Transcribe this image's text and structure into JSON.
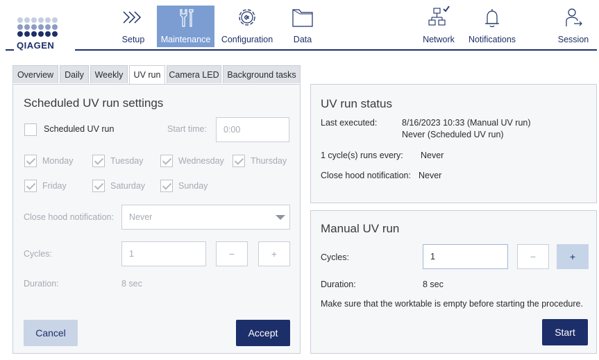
{
  "logo": {
    "text": "QIAGEN"
  },
  "nav": {
    "setup": "Setup",
    "maintenance": "Maintenance",
    "configuration": "Configuration",
    "data": "Data",
    "network": "Network",
    "notifications": "Notifications",
    "session": "Session"
  },
  "tabs": [
    "Overview",
    "Daily",
    "Weekly",
    "UV run",
    "Camera LED",
    "Background tasks"
  ],
  "scheduled": {
    "title": "Scheduled UV run settings",
    "checkbox_label": "Scheduled UV run",
    "start_time_label": "Start time:",
    "start_time_value": "0:00",
    "days": [
      "Monday",
      "Tuesday",
      "Wednesday",
      "Thursday",
      "Friday",
      "Saturday",
      "Sunday"
    ],
    "close_hood_label": "Close hood notification:",
    "close_hood_value": "Never",
    "cycles_label": "Cycles:",
    "cycles_value": "1",
    "minus": "−",
    "plus": "+",
    "duration_label": "Duration:",
    "duration_value": "8 sec",
    "cancel": "Cancel",
    "accept": "Accept"
  },
  "status": {
    "title": "UV run status",
    "last_executed_label": "Last executed:",
    "last_executed_line1": "8/16/2023 10:33 (Manual UV run)",
    "last_executed_line2": "Never (Scheduled UV run)",
    "cycle_every_label": "1 cycle(s) runs every:",
    "cycle_every_value": "Never",
    "close_hood_label": "Close hood notification:",
    "close_hood_value": "Never"
  },
  "manual": {
    "title": "Manual UV run",
    "cycles_label": "Cycles:",
    "cycles_value": "1",
    "minus": "−",
    "plus": "+",
    "duration_label": "Duration:",
    "duration_value": "8 sec",
    "notice": "Make sure that the worktable is empty before starting the procedure.",
    "start": "Start"
  },
  "colors": {
    "brand": "#1c2f69",
    "active_nav": "#7b9dd2",
    "primary_button": "#1d2f6a",
    "secondary_button": "#c9d5e6"
  }
}
